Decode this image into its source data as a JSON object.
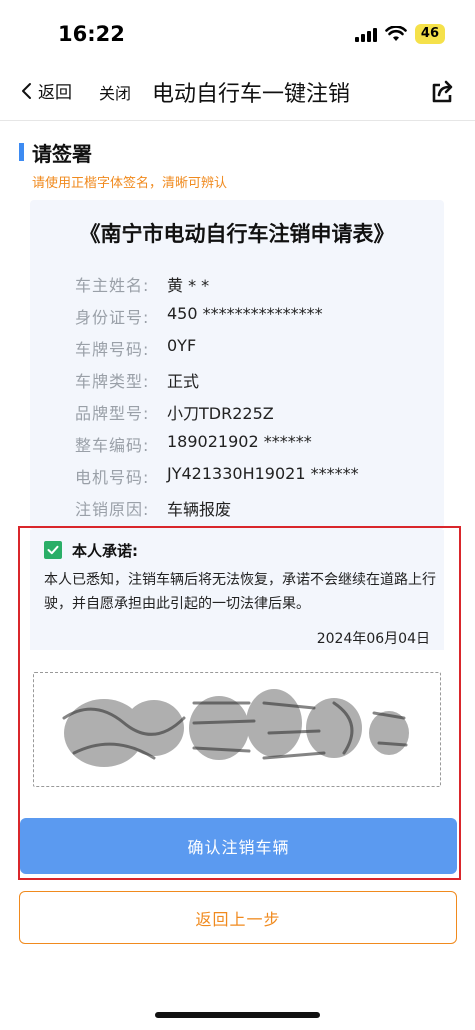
{
  "status": {
    "time": "16:22",
    "battery": "46"
  },
  "nav": {
    "back_label": "返回",
    "close_label": "关闭",
    "title": "电动自行车一键注销"
  },
  "section": {
    "title": "请签署",
    "hint": "请使用正楷字体签名，清晰可辨认"
  },
  "form": {
    "title": "《南宁市电动自行车注销申请表》",
    "rows": [
      {
        "label": "车主姓名:",
        "value": "黄 * *"
      },
      {
        "label": "身份证号:",
        "value": "450 ***************"
      },
      {
        "label": "车牌号码:",
        "value": "0YF"
      },
      {
        "label": "车牌类型:",
        "value": "正式"
      },
      {
        "label": "品牌型号:",
        "value": "小刀TDR225Z"
      },
      {
        "label": "整车编码:",
        "value": "189021902 ******"
      },
      {
        "label": "电机号码:",
        "value": "JY421330H19021 ******"
      },
      {
        "label": "注销原因:",
        "value": "车辆报废"
      }
    ]
  },
  "promise": {
    "title": "本人承诺:",
    "text": "本人已悉知，注销车辆后将无法恢复，承诺不会继续在道路上行驶，并自愿承担由此引起的一切法律后果。",
    "date": "2024年06月04日",
    "checked": true
  },
  "buttons": {
    "confirm_label": "确认注销车辆",
    "back_label": "返回上一步"
  },
  "colors": {
    "accent_blue": "#5b9af0",
    "section_bar": "#3d8bf2",
    "hint_orange": "#f08a1e",
    "highlight_red": "#d9262b",
    "check_green": "#2aae67"
  }
}
